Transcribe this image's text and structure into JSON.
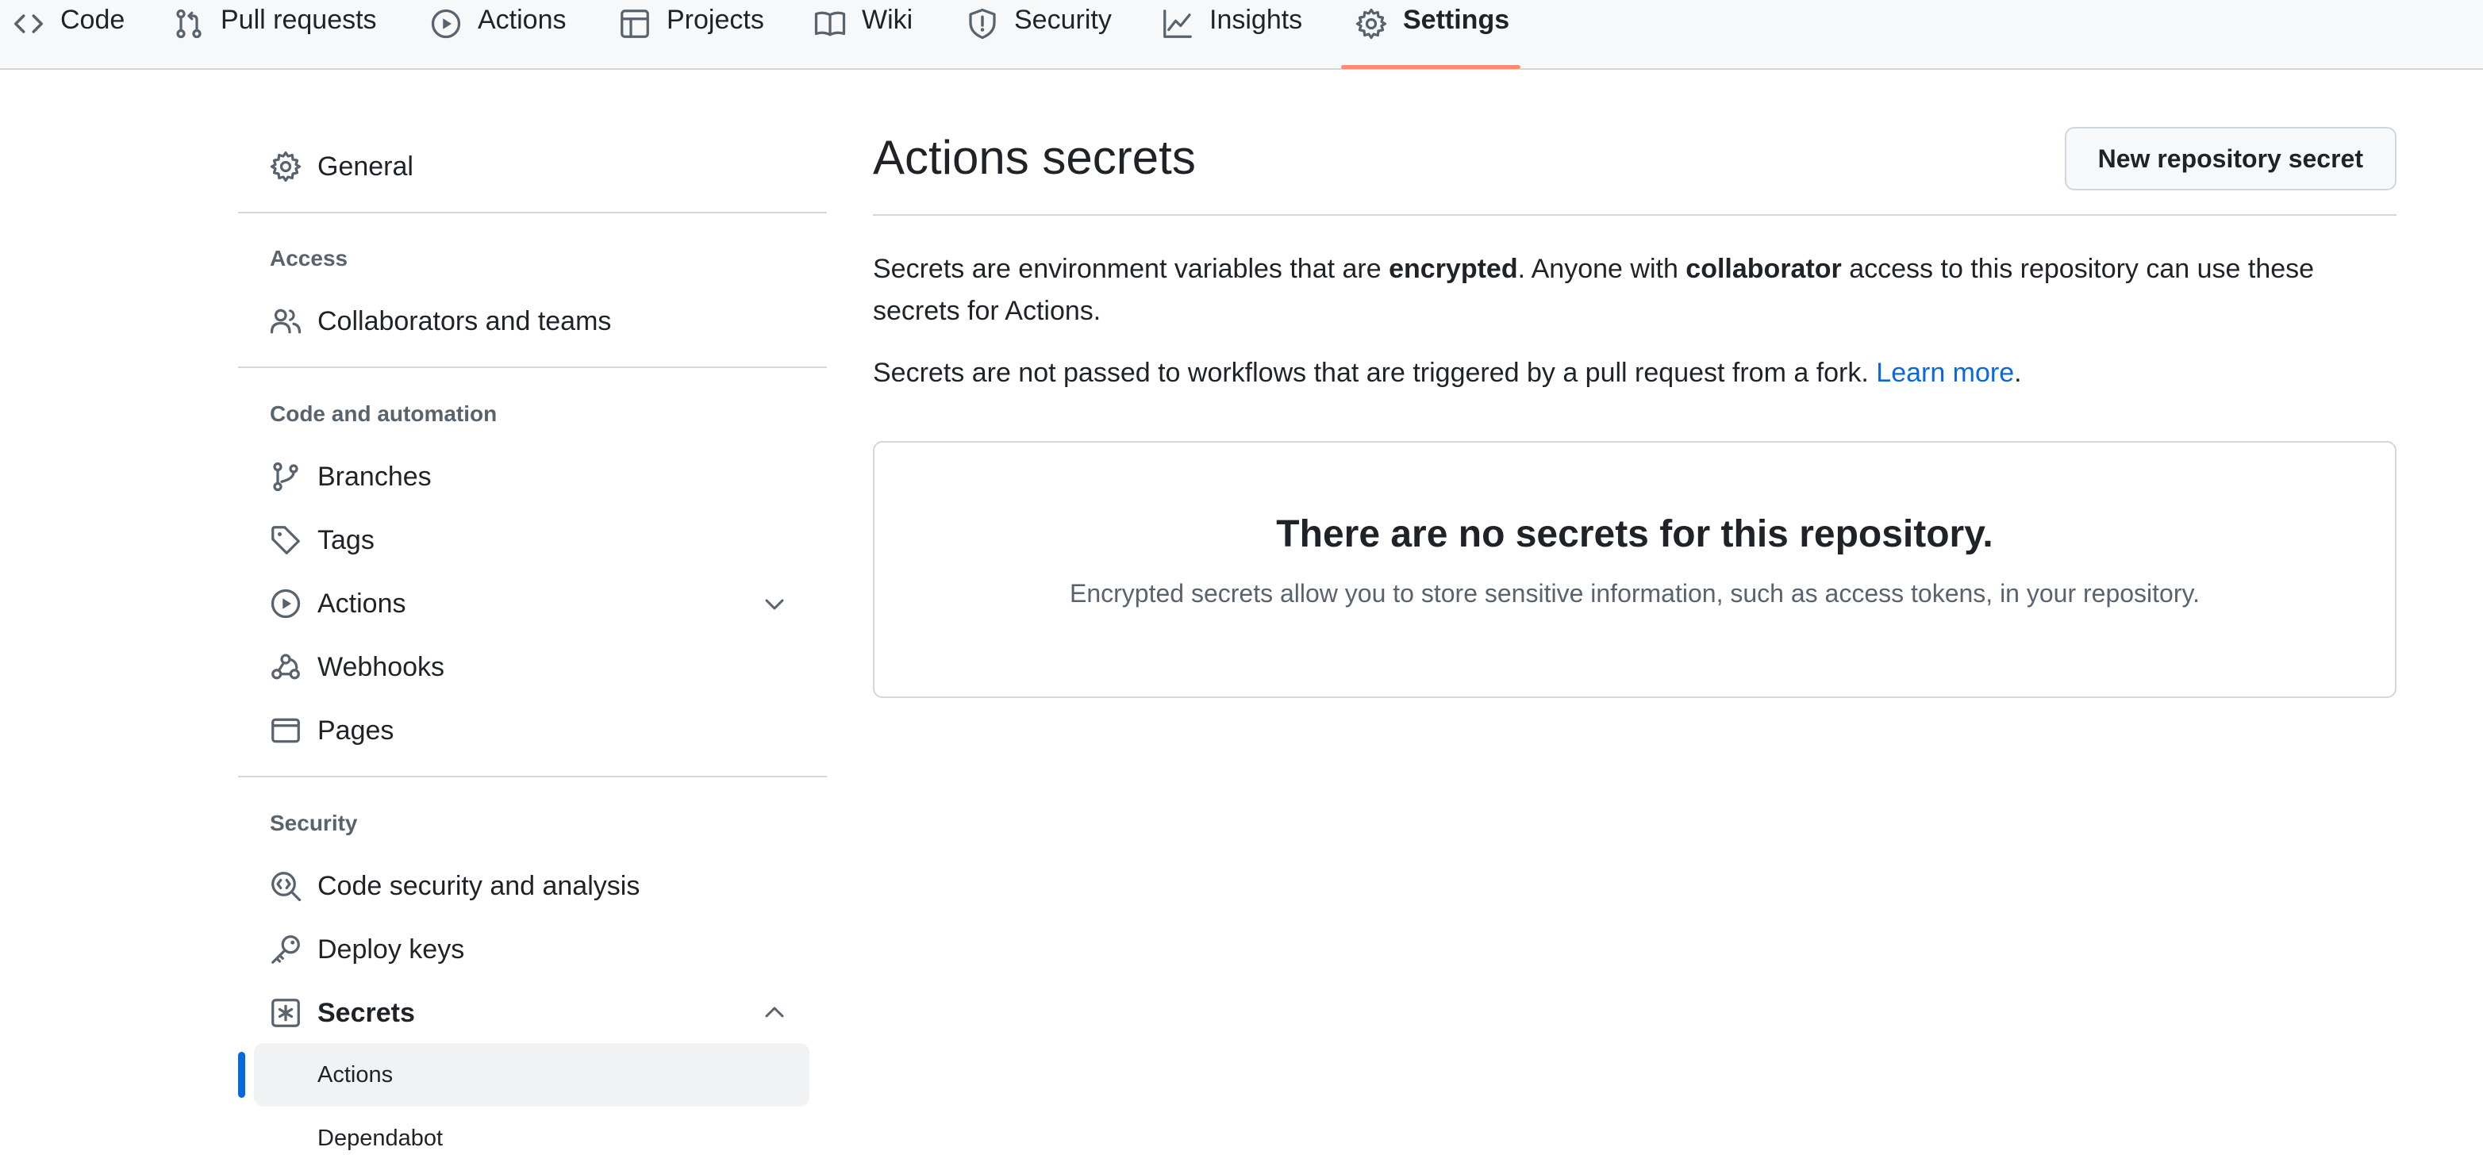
{
  "topnav": {
    "tabs": [
      {
        "label": "Code",
        "icon": "code-icon"
      },
      {
        "label": "Pull requests",
        "icon": "git-pull-request-icon"
      },
      {
        "label": "Actions",
        "icon": "play-icon"
      },
      {
        "label": "Projects",
        "icon": "table-icon"
      },
      {
        "label": "Wiki",
        "icon": "book-icon"
      },
      {
        "label": "Security",
        "icon": "shield-icon"
      },
      {
        "label": "Insights",
        "icon": "graph-icon"
      },
      {
        "label": "Settings",
        "icon": "gear-icon",
        "selected": true
      }
    ]
  },
  "sidebar": {
    "general": "General",
    "access_heading": "Access",
    "collaborators": "Collaborators and teams",
    "code_heading": "Code and automation",
    "branches": "Branches",
    "tags": "Tags",
    "actions": "Actions",
    "webhooks": "Webhooks",
    "pages": "Pages",
    "security_heading": "Security",
    "code_security": "Code security and analysis",
    "deploy_keys": "Deploy keys",
    "secrets": "Secrets",
    "secrets_actions": "Actions",
    "secrets_dependabot": "Dependabot"
  },
  "main": {
    "title": "Actions secrets",
    "new_button": "New repository secret",
    "para1": {
      "part1": "Secrets are environment variables that are ",
      "bold1": "encrypted",
      "part2": ". Anyone with ",
      "bold2": "collaborator",
      "part3": " access to this repository can use these secrets for Actions."
    },
    "para2": {
      "text": "Secrets are not passed to workflows that are triggered by a pull request from a fork. ",
      "link": "Learn more",
      "end": "."
    },
    "empty": {
      "heading": "There are no secrets for this repository.",
      "description": "Encrypted secrets allow you to store sensitive information, such as access tokens, in your repository."
    }
  },
  "colors": {
    "accent": "#0969da",
    "tab_underline": "#fd8c73",
    "border": "#d0d7de",
    "muted_text": "#59636e"
  }
}
